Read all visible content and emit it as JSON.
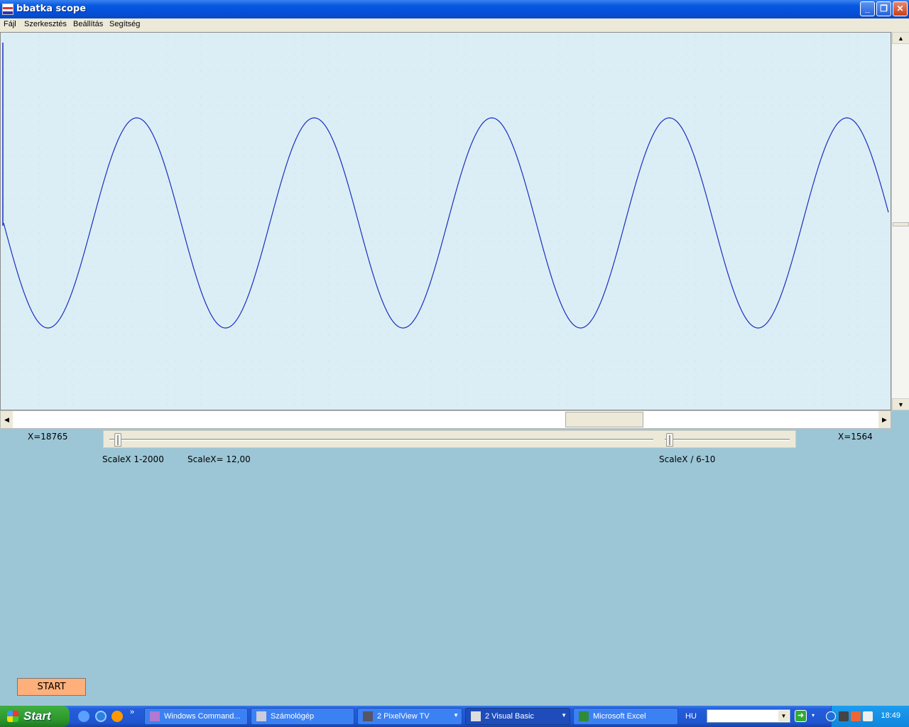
{
  "window": {
    "title": "bbatka scope"
  },
  "menu": {
    "items": [
      "Fájl",
      "Szerkesztés",
      "Beállítás",
      "Segítség"
    ]
  },
  "labels": {
    "x_left": "X=18765",
    "x_right": "X=1564",
    "scale_range": "ScaleX 1-2000",
    "scale_value": "ScaleX= 12,00",
    "scale_div": "ScaleX / 6-10"
  },
  "start_button": "START",
  "taskbar": {
    "start_label": "Start",
    "tasks": [
      {
        "label": "Windows Command...",
        "active": false
      },
      {
        "label": "Számológép",
        "active": false
      },
      {
        "label": "2 PixelView TV",
        "active": false
      },
      {
        "label": "2 Visual Basic",
        "active": true
      },
      {
        "label": "Microsoft Excel",
        "active": false
      }
    ],
    "language": "HU",
    "clock": "18:49"
  },
  "signal": {
    "waveform": "sine",
    "color": "#1a2ec0",
    "periods_visible": 5,
    "phase": "start-at-mid-descending"
  }
}
